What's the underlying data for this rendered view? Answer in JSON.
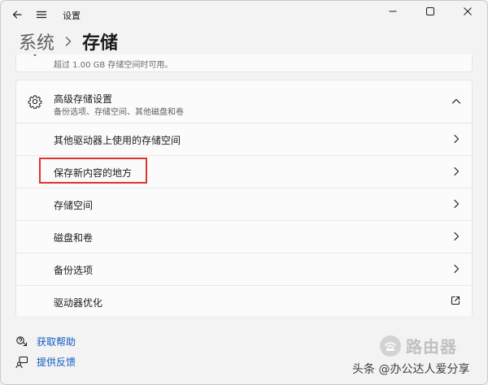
{
  "titlebar": {
    "app_title": "设置"
  },
  "breadcrumb": {
    "parent": "系统",
    "current": "存储"
  },
  "partial_card": {
    "text": "超过 1.00 GB 存储空间时可用。"
  },
  "advanced": {
    "title": "高级存储设置",
    "subtitle": "备份选项、存储空间、其他磁盘和卷",
    "items": [
      {
        "label": "其他驱动器上使用的存储空间",
        "icon": "chevron-right-icon"
      },
      {
        "label": "保存新内容的地方",
        "icon": "chevron-right-icon"
      },
      {
        "label": "存储空间",
        "icon": "chevron-right-icon"
      },
      {
        "label": "磁盘和卷",
        "icon": "chevron-right-icon"
      },
      {
        "label": "备份选项",
        "icon": "chevron-right-icon"
      },
      {
        "label": "驱动器优化",
        "icon": "external-link-icon"
      }
    ]
  },
  "footer": {
    "help": "获取帮助",
    "feedback": "提供反馈"
  },
  "watermark": {
    "logo_text": "路由器",
    "caption": "头条 @办公达人爱分享"
  },
  "colors": {
    "accent_link": "#0f5cbf",
    "highlight": "#e0332e",
    "background": "#f3f3f3",
    "card": "#fbfbfb"
  }
}
